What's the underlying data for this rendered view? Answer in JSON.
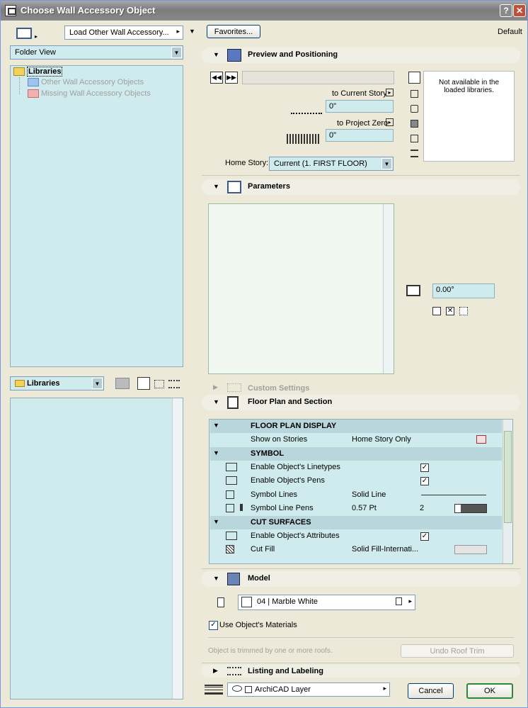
{
  "window": {
    "title": "Choose Wall Accessory Object",
    "help": "?",
    "close": "✕"
  },
  "left": {
    "load_button": "Load Other Wall Accessory...",
    "view_select": "Folder View",
    "tree": {
      "root": "Libraries",
      "items": [
        "Other Wall Accessory Objects",
        "Missing Wall Accessory Objects"
      ]
    },
    "bottom_select": "Libraries"
  },
  "top": {
    "favorites": "Favorites...",
    "default_label": "Default"
  },
  "preview": {
    "title": "Preview and Positioning",
    "to_current_story": "to Current Story",
    "current_story_value": "0\"",
    "to_project_zero": "to Project Zero",
    "project_zero_value": "0\"",
    "home_story_label": "Home Story:",
    "home_story_value": "Current (1. FIRST FLOOR)",
    "preview_message": "Not available in the loaded libraries."
  },
  "parameters": {
    "title": "Parameters",
    "angle": "0.00°"
  },
  "custom_settings": {
    "title": "Custom Settings"
  },
  "floor_plan": {
    "title": "Floor Plan and Section",
    "rows": [
      {
        "type": "header",
        "label": "FLOOR PLAN DISPLAY"
      },
      {
        "type": "row",
        "label": "Show on Stories",
        "value": "Home Story Only"
      },
      {
        "type": "header",
        "label": "SYMBOL"
      },
      {
        "type": "row",
        "label": "Enable Object's Linetypes",
        "value": "",
        "check": "✓"
      },
      {
        "type": "row",
        "label": "Enable Object's Pens",
        "value": "",
        "check": "✓"
      },
      {
        "type": "row",
        "label": "Symbol Lines",
        "value": "Solid Line"
      },
      {
        "type": "row",
        "label": "Symbol Line Pens",
        "value": "0.57 Pt",
        "num": "2"
      },
      {
        "type": "header",
        "label": "CUT SURFACES"
      },
      {
        "type": "row",
        "label": "Enable Object's Attributes",
        "value": "",
        "check": "✓"
      },
      {
        "type": "row",
        "label": "Cut Fill",
        "value": "Solid Fill-Internati..."
      }
    ]
  },
  "model": {
    "title": "Model",
    "material": "04 | Marble White",
    "use_materials": "Use Object's Materials",
    "use_materials_check": "✓",
    "trim_note": "Object is trimmed by one or more roofs.",
    "undo_roof_trim": "Undo Roof Trim"
  },
  "listing": {
    "title": "Listing and Labeling"
  },
  "footer": {
    "layer": "ArchiCAD Layer",
    "cancel": "Cancel",
    "ok": "OK"
  }
}
